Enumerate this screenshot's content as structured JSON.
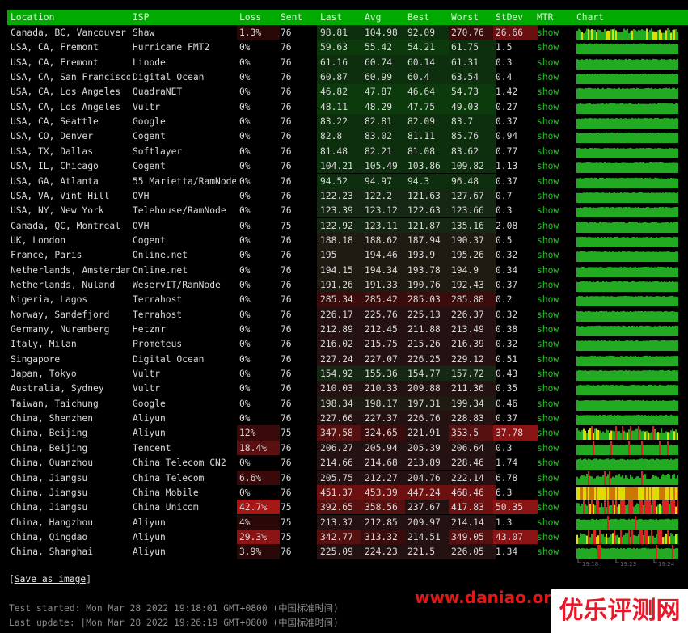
{
  "header": {
    "location": "Location",
    "isp": "ISP",
    "loss": "Loss",
    "sent": "Sent",
    "last": "Last",
    "avg": "Avg",
    "best": "Best",
    "worst": "Worst",
    "stdev": "StDev",
    "mtr": "MTR",
    "chart": "Chart"
  },
  "rows": [
    {
      "location": "Canada, BC, Vancouver",
      "isp": "Shaw",
      "loss": "1.3%",
      "sent": "76",
      "last": "98.81",
      "avg": "104.98",
      "best": "92.09",
      "worst": "270.76",
      "stdev": "26.66",
      "mtr": "show"
    },
    {
      "location": "USA, CA, Fremont",
      "isp": "Hurricane FMT2",
      "loss": "0%",
      "sent": "76",
      "last": "59.63",
      "avg": "55.42",
      "best": "54.21",
      "worst": "61.75",
      "stdev": "1.5",
      "mtr": "show"
    },
    {
      "location": "USA, CA, Fremont",
      "isp": "Linode",
      "loss": "0%",
      "sent": "76",
      "last": "61.16",
      "avg": "60.74",
      "best": "60.14",
      "worst": "61.31",
      "stdev": "0.3",
      "mtr": "show"
    },
    {
      "location": "USA, CA, San Francisco",
      "isp": "Digital Ocean",
      "loss": "0%",
      "sent": "76",
      "last": "60.87",
      "avg": "60.99",
      "best": "60.4",
      "worst": "63.54",
      "stdev": "0.4",
      "mtr": "show"
    },
    {
      "location": "USA, CA, Los Angeles",
      "isp": "QuadraNET",
      "loss": "0%",
      "sent": "76",
      "last": "46.82",
      "avg": "47.87",
      "best": "46.64",
      "worst": "54.73",
      "stdev": "1.42",
      "mtr": "show"
    },
    {
      "location": "USA, CA, Los Angeles",
      "isp": "Vultr",
      "loss": "0%",
      "sent": "76",
      "last": "48.11",
      "avg": "48.29",
      "best": "47.75",
      "worst": "49.03",
      "stdev": "0.27",
      "mtr": "show"
    },
    {
      "location": "USA, CA, Seattle",
      "isp": "Google",
      "loss": "0%",
      "sent": "76",
      "last": "83.22",
      "avg": "82.81",
      "best": "82.09",
      "worst": "83.7",
      "stdev": "0.37",
      "mtr": "show"
    },
    {
      "location": "USA, CO, Denver",
      "isp": "Cogent",
      "loss": "0%",
      "sent": "76",
      "last": "82.8",
      "avg": "83.02",
      "best": "81.11",
      "worst": "85.76",
      "stdev": "0.94",
      "mtr": "show"
    },
    {
      "location": "USA, TX, Dallas",
      "isp": "Softlayer",
      "loss": "0%",
      "sent": "76",
      "last": "81.48",
      "avg": "82.21",
      "best": "81.08",
      "worst": "83.62",
      "stdev": "0.77",
      "mtr": "show"
    },
    {
      "location": "USA, IL, Chicago",
      "isp": "Cogent",
      "loss": "0%",
      "sent": "76",
      "last": "104.21",
      "avg": "105.49",
      "best": "103.86",
      "worst": "109.82",
      "stdev": "1.13",
      "mtr": "show"
    },
    {
      "location": "USA, GA, Atlanta",
      "isp": "55 Marietta/RamNode",
      "loss": "0%",
      "sent": "76",
      "last": "94.52",
      "avg": "94.97",
      "best": "94.3",
      "worst": "96.48",
      "stdev": "0.37",
      "mtr": "show"
    },
    {
      "location": "USA, VA, Vint Hill",
      "isp": "OVH",
      "loss": "0%",
      "sent": "76",
      "last": "122.23",
      "avg": "122.2",
      "best": "121.63",
      "worst": "127.67",
      "stdev": "0.7",
      "mtr": "show"
    },
    {
      "location": "USA, NY, New York",
      "isp": "Telehouse/RamNode",
      "loss": "0%",
      "sent": "76",
      "last": "123.39",
      "avg": "123.12",
      "best": "122.63",
      "worst": "123.66",
      "stdev": "0.3",
      "mtr": "show"
    },
    {
      "location": "Canada, QC, Montreal",
      "isp": "OVH",
      "loss": "0%",
      "sent": "75",
      "last": "122.92",
      "avg": "123.11",
      "best": "121.87",
      "worst": "135.16",
      "stdev": "2.08",
      "mtr": "show"
    },
    {
      "location": "UK, London",
      "isp": "Cogent",
      "loss": "0%",
      "sent": "76",
      "last": "188.18",
      "avg": "188.62",
      "best": "187.94",
      "worst": "190.37",
      "stdev": "0.5",
      "mtr": "show"
    },
    {
      "location": "France, Paris",
      "isp": "Online.net",
      "loss": "0%",
      "sent": "76",
      "last": "195",
      "avg": "194.46",
      "best": "193.9",
      "worst": "195.26",
      "stdev": "0.32",
      "mtr": "show"
    },
    {
      "location": "Netherlands, Amsterdam",
      "isp": "Online.net",
      "loss": "0%",
      "sent": "76",
      "last": "194.15",
      "avg": "194.34",
      "best": "193.78",
      "worst": "194.9",
      "stdev": "0.34",
      "mtr": "show"
    },
    {
      "location": "Netherlands, Nuland",
      "isp": "WeservIT/RamNode",
      "loss": "0%",
      "sent": "76",
      "last": "191.26",
      "avg": "191.33",
      "best": "190.76",
      "worst": "192.43",
      "stdev": "0.37",
      "mtr": "show"
    },
    {
      "location": "Nigeria, Lagos",
      "isp": "Terrahost",
      "loss": "0%",
      "sent": "76",
      "last": "285.34",
      "avg": "285.42",
      "best": "285.03",
      "worst": "285.88",
      "stdev": "0.2",
      "mtr": "show"
    },
    {
      "location": "Norway, Sandefjord",
      "isp": "Terrahost",
      "loss": "0%",
      "sent": "76",
      "last": "226.17",
      "avg": "225.76",
      "best": "225.13",
      "worst": "226.37",
      "stdev": "0.32",
      "mtr": "show"
    },
    {
      "location": "Germany, Nuremberg",
      "isp": "Hetznr",
      "loss": "0%",
      "sent": "76",
      "last": "212.89",
      "avg": "212.45",
      "best": "211.88",
      "worst": "213.49",
      "stdev": "0.38",
      "mtr": "show"
    },
    {
      "location": "Italy, Milan",
      "isp": "Prometeus",
      "loss": "0%",
      "sent": "76",
      "last": "216.02",
      "avg": "215.75",
      "best": "215.26",
      "worst": "216.39",
      "stdev": "0.32",
      "mtr": "show"
    },
    {
      "location": "Singapore",
      "isp": "Digital Ocean",
      "loss": "0%",
      "sent": "76",
      "last": "227.24",
      "avg": "227.07",
      "best": "226.25",
      "worst": "229.12",
      "stdev": "0.51",
      "mtr": "show"
    },
    {
      "location": "Japan, Tokyo",
      "isp": "Vultr",
      "loss": "0%",
      "sent": "76",
      "last": "154.92",
      "avg": "155.36",
      "best": "154.77",
      "worst": "157.72",
      "stdev": "0.43",
      "mtr": "show"
    },
    {
      "location": "Australia, Sydney",
      "isp": "Vultr",
      "loss": "0%",
      "sent": "76",
      "last": "210.03",
      "avg": "210.33",
      "best": "209.88",
      "worst": "211.36",
      "stdev": "0.35",
      "mtr": "show"
    },
    {
      "location": "Taiwan, Taichung",
      "isp": "Google",
      "loss": "0%",
      "sent": "76",
      "last": "198.34",
      "avg": "198.17",
      "best": "197.31",
      "worst": "199.34",
      "stdev": "0.46",
      "mtr": "show"
    },
    {
      "location": "China, Shenzhen",
      "isp": "Aliyun",
      "loss": "0%",
      "sent": "76",
      "last": "227.66",
      "avg": "227.37",
      "best": "226.76",
      "worst": "228.83",
      "stdev": "0.37",
      "mtr": "show"
    },
    {
      "location": "China, Beijing",
      "isp": "Aliyun",
      "loss": "12%",
      "sent": "75",
      "last": "347.58",
      "avg": "324.65",
      "best": "221.91",
      "worst": "353.5",
      "stdev": "37.78",
      "mtr": "show"
    },
    {
      "location": "China, Beijing",
      "isp": "Tencent",
      "loss": "18.4%",
      "sent": "76",
      "last": "206.27",
      "avg": "205.94",
      "best": "205.39",
      "worst": "206.64",
      "stdev": "0.3",
      "mtr": "show"
    },
    {
      "location": "China, Quanzhou",
      "isp": "China Telecom CN2",
      "loss": "0%",
      "sent": "76",
      "last": "214.66",
      "avg": "214.68",
      "best": "213.89",
      "worst": "228.46",
      "stdev": "1.74",
      "mtr": "show"
    },
    {
      "location": "China, Jiangsu",
      "isp": "China Telecom",
      "loss": "6.6%",
      "sent": "76",
      "last": "205.75",
      "avg": "212.27",
      "best": "204.76",
      "worst": "222.14",
      "stdev": "6.78",
      "mtr": "show"
    },
    {
      "location": "China, Jiangsu",
      "isp": "China Mobile",
      "loss": "0%",
      "sent": "76",
      "last": "451.37",
      "avg": "453.39",
      "best": "447.24",
      "worst": "468.46",
      "stdev": "6.3",
      "mtr": "show"
    },
    {
      "location": "China, Jiangsu",
      "isp": "China Unicom",
      "loss": "42.7%",
      "sent": "75",
      "last": "392.65",
      "avg": "358.56",
      "best": "237.67",
      "worst": "417.83",
      "stdev": "50.35",
      "mtr": "show"
    },
    {
      "location": "China, Hangzhou",
      "isp": "Aliyun",
      "loss": "4%",
      "sent": "75",
      "last": "213.37",
      "avg": "212.85",
      "best": "209.97",
      "worst": "214.14",
      "stdev": "1.3",
      "mtr": "show"
    },
    {
      "location": "China, Qingdao",
      "isp": "Aliyun",
      "loss": "29.3%",
      "sent": "75",
      "last": "342.77",
      "avg": "313.32",
      "best": "214.51",
      "worst": "349.05",
      "stdev": "43.07",
      "mtr": "show"
    },
    {
      "location": "China, Shanghai",
      "isp": "Aliyun",
      "loss": "3.9%",
      "sent": "76",
      "last": "225.09",
      "avg": "224.23",
      "best": "221.5",
      "worst": "226.05",
      "stdev": "1.34",
      "mtr": "show"
    }
  ],
  "chart_axis": [
    "19:18",
    "19:23",
    "19:24"
  ],
  "footer": {
    "save_link": "Save as image",
    "test_started": "Test started: Mon Mar 28 2022 19:18:01 GMT+0800 (中国标准时间)",
    "last_update": "Last update: |Mon Mar 28 2022 19:26:19 GMT+0800 (中国标准时间)"
  },
  "watermark": {
    "url": "www.daniao.or",
    "brand": "优乐评测网"
  },
  "colors": {
    "header_bg": "#00aa00",
    "link": "#22c522",
    "chart_ok": "#22aa22",
    "chart_warn": "#dddd00",
    "chart_loss": "#dd2222",
    "watermark": "#e01818"
  }
}
